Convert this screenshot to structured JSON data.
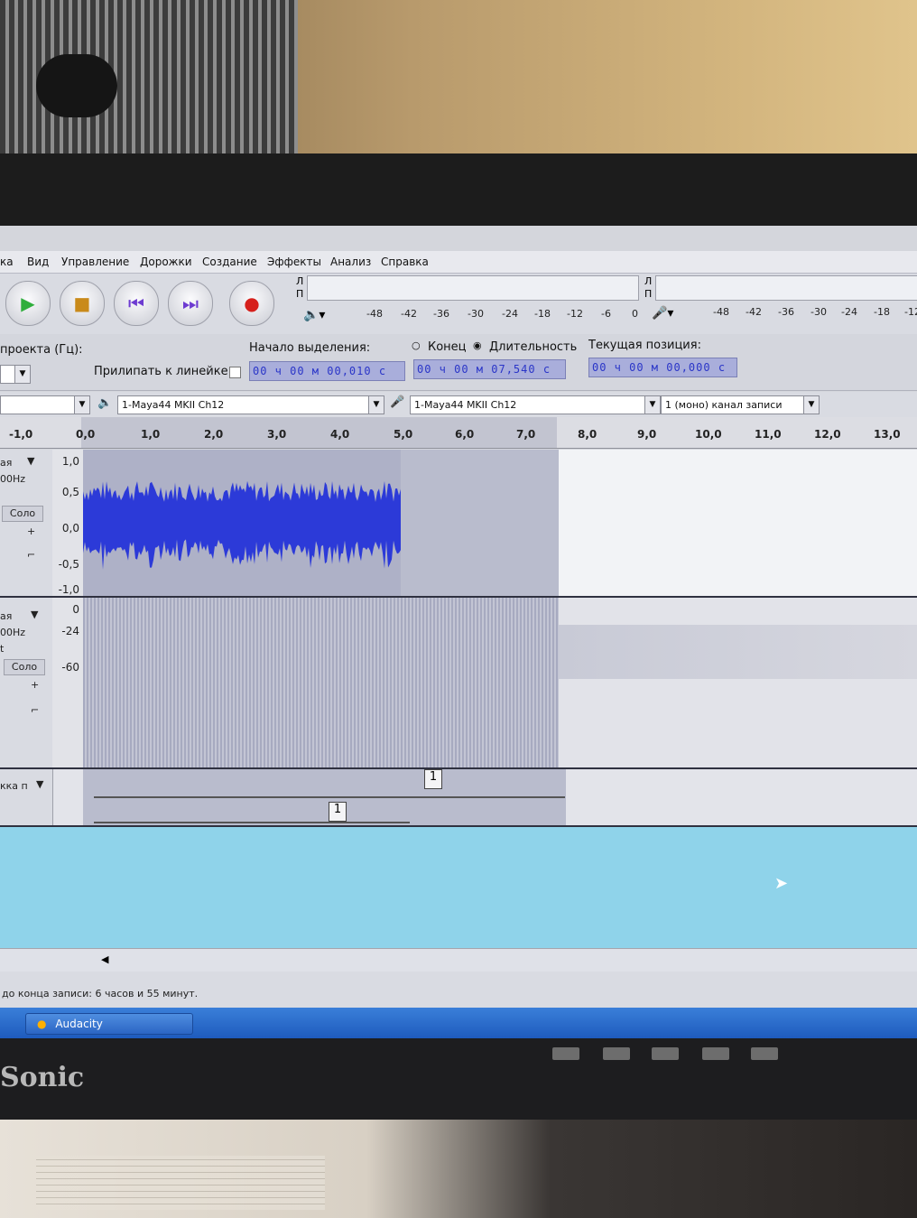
{
  "app": {
    "name": "Audacity"
  },
  "menu": {
    "items": [
      "ка",
      "Вид",
      "Управление",
      "Дорожки",
      "Создание",
      "Эффекты",
      "Анализ",
      "Справка"
    ]
  },
  "meters": {
    "play_channels": [
      "Л",
      "П"
    ],
    "record_channels": [
      "Л",
      "П"
    ],
    "play_scale": [
      "-48",
      "-42",
      "-36",
      "-30",
      "-24",
      "-18",
      "-12",
      "-6",
      "0"
    ],
    "record_scale": [
      "-48",
      "-42",
      "-36",
      "-30",
      "-24",
      "-18",
      "-12"
    ]
  },
  "selection": {
    "project_rate_label": "проекта (Гц):",
    "snap_label": "Прилипать к линейке",
    "start_label": "Начало выделения:",
    "start_value": "00 ч 00 м 00,010 с",
    "end_radio": "Конец",
    "length_radio": "Длительность",
    "length_value": "00 ч 00 м 07,540 с",
    "position_label": "Текущая позиция:",
    "position_value": "00 ч 00 м 00,000 с"
  },
  "devices": {
    "playback": "1-Maya44 MKII Ch12",
    "recording": "1-Maya44 MKII Ch12",
    "channels": "1 (моно) канал записи"
  },
  "ruler": {
    "ticks": [
      "-1,0",
      "0,0",
      "1,0",
      "2,0",
      "3,0",
      "4,0",
      "5,0",
      "6,0",
      "7,0",
      "8,0",
      "9,0",
      "10,0",
      "11,0",
      "12,0",
      "13,0"
    ]
  },
  "tracks": [
    {
      "name": "ая",
      "rate": "00Hz",
      "solo": "Соло",
      "scale": [
        "1,0",
        "0,5",
        "0,0",
        "-0,5",
        "-1,0"
      ]
    },
    {
      "name": "ая",
      "rate": "00Hz",
      "extra": "t",
      "solo": "Соло",
      "scale": [
        "0",
        "-24",
        "-60"
      ]
    }
  ],
  "label_track": {
    "name": "кка п",
    "labels": [
      "1",
      "1"
    ]
  },
  "status": {
    "text": "до конца записи: 6 часов и 55 минут."
  },
  "taskbar": {
    "app_button": "Audacity"
  },
  "monitor": {
    "brand": "Sonic"
  },
  "colors": {
    "waveform": "#2c3ad8",
    "selection": "#b9bccd",
    "timecode_text": "#2a35c8",
    "play": "#2fae3c",
    "record": "#d6201c",
    "transport_icons": "#6d3bd1"
  }
}
